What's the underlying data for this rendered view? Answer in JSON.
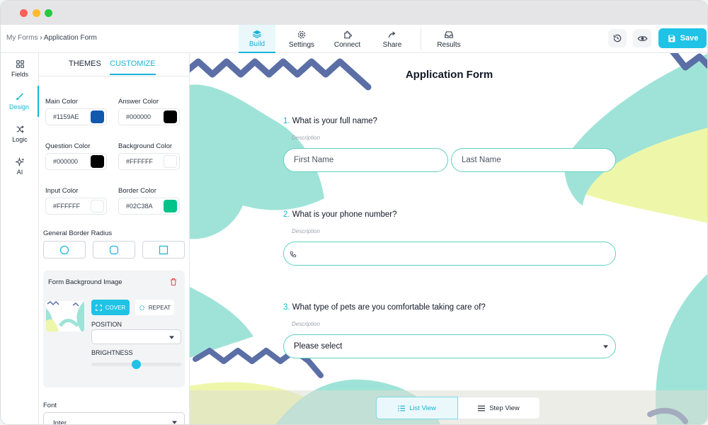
{
  "breadcrumb": {
    "root": "My Forms",
    "separator": "›",
    "current": "Application Form"
  },
  "nav": {
    "tabs": [
      {
        "label": "Build",
        "icon": "layers-icon",
        "active": true
      },
      {
        "label": "Settings",
        "icon": "gear-icon"
      },
      {
        "label": "Connect",
        "icon": "puzzle-icon"
      },
      {
        "label": "Share",
        "icon": "share-arrow-icon"
      },
      {
        "label": "Results",
        "icon": "inbox-icon"
      }
    ]
  },
  "toolbar": {
    "save_label": "Save",
    "history_icon": "history-icon",
    "preview_icon": "eye-icon"
  },
  "rail": {
    "items": [
      {
        "label": "Fields",
        "icon": "grid-icon"
      },
      {
        "label": "Design",
        "icon": "brush-icon",
        "active": true
      },
      {
        "label": "Logic",
        "icon": "shuffle-icon"
      },
      {
        "label": "AI",
        "icon": "sparkles-icon"
      }
    ]
  },
  "panel": {
    "tabs": [
      {
        "label": "THEMES"
      },
      {
        "label": "CUSTOMIZE",
        "active": true
      }
    ],
    "colors": [
      {
        "label": "Main Color",
        "value": "#1159AE"
      },
      {
        "label": "Answer Color",
        "value": "#000000"
      },
      {
        "label": "Question Color",
        "value": "#000000"
      },
      {
        "label": "Background Color",
        "value": "#FFFFFF"
      },
      {
        "label": "Input Color",
        "value": "#FFFFFF"
      },
      {
        "label": "Border Color",
        "value": "#02C38A"
      }
    ],
    "border_radius_label": "General Border Radius",
    "bg_image": {
      "title": "Form Background Image",
      "cover_label": "COVER",
      "repeat_label": "REPEAT",
      "position_label": "POSITION",
      "position_value": "",
      "brightness_label": "BRIGHTNESS",
      "brightness": 0.5
    },
    "font_label": "Font",
    "font_value": "Inter"
  },
  "form": {
    "title": "Application Form",
    "questions": [
      {
        "num": "1.",
        "text": "What is your full name?",
        "description": "Description",
        "first_placeholder": "First Name",
        "last_placeholder": "Last Name"
      },
      {
        "num": "2.",
        "text": "What is your phone number?",
        "description": "Description"
      },
      {
        "num": "3.",
        "text": "What type of pets are you comfortable taking care of?",
        "description": "Description",
        "select_value": "Please select"
      }
    ]
  },
  "views": {
    "list_label": "List View",
    "step_label": "Step View",
    "active": "list"
  },
  "theme_colors": {
    "accent": "#19b3d6",
    "save": "#1ec3e6",
    "field_border": "#5fd0c0",
    "bg_teal": "#9fe3d8",
    "bg_yellow": "#eef7a9",
    "bg_wave": "#5b6fa6"
  }
}
